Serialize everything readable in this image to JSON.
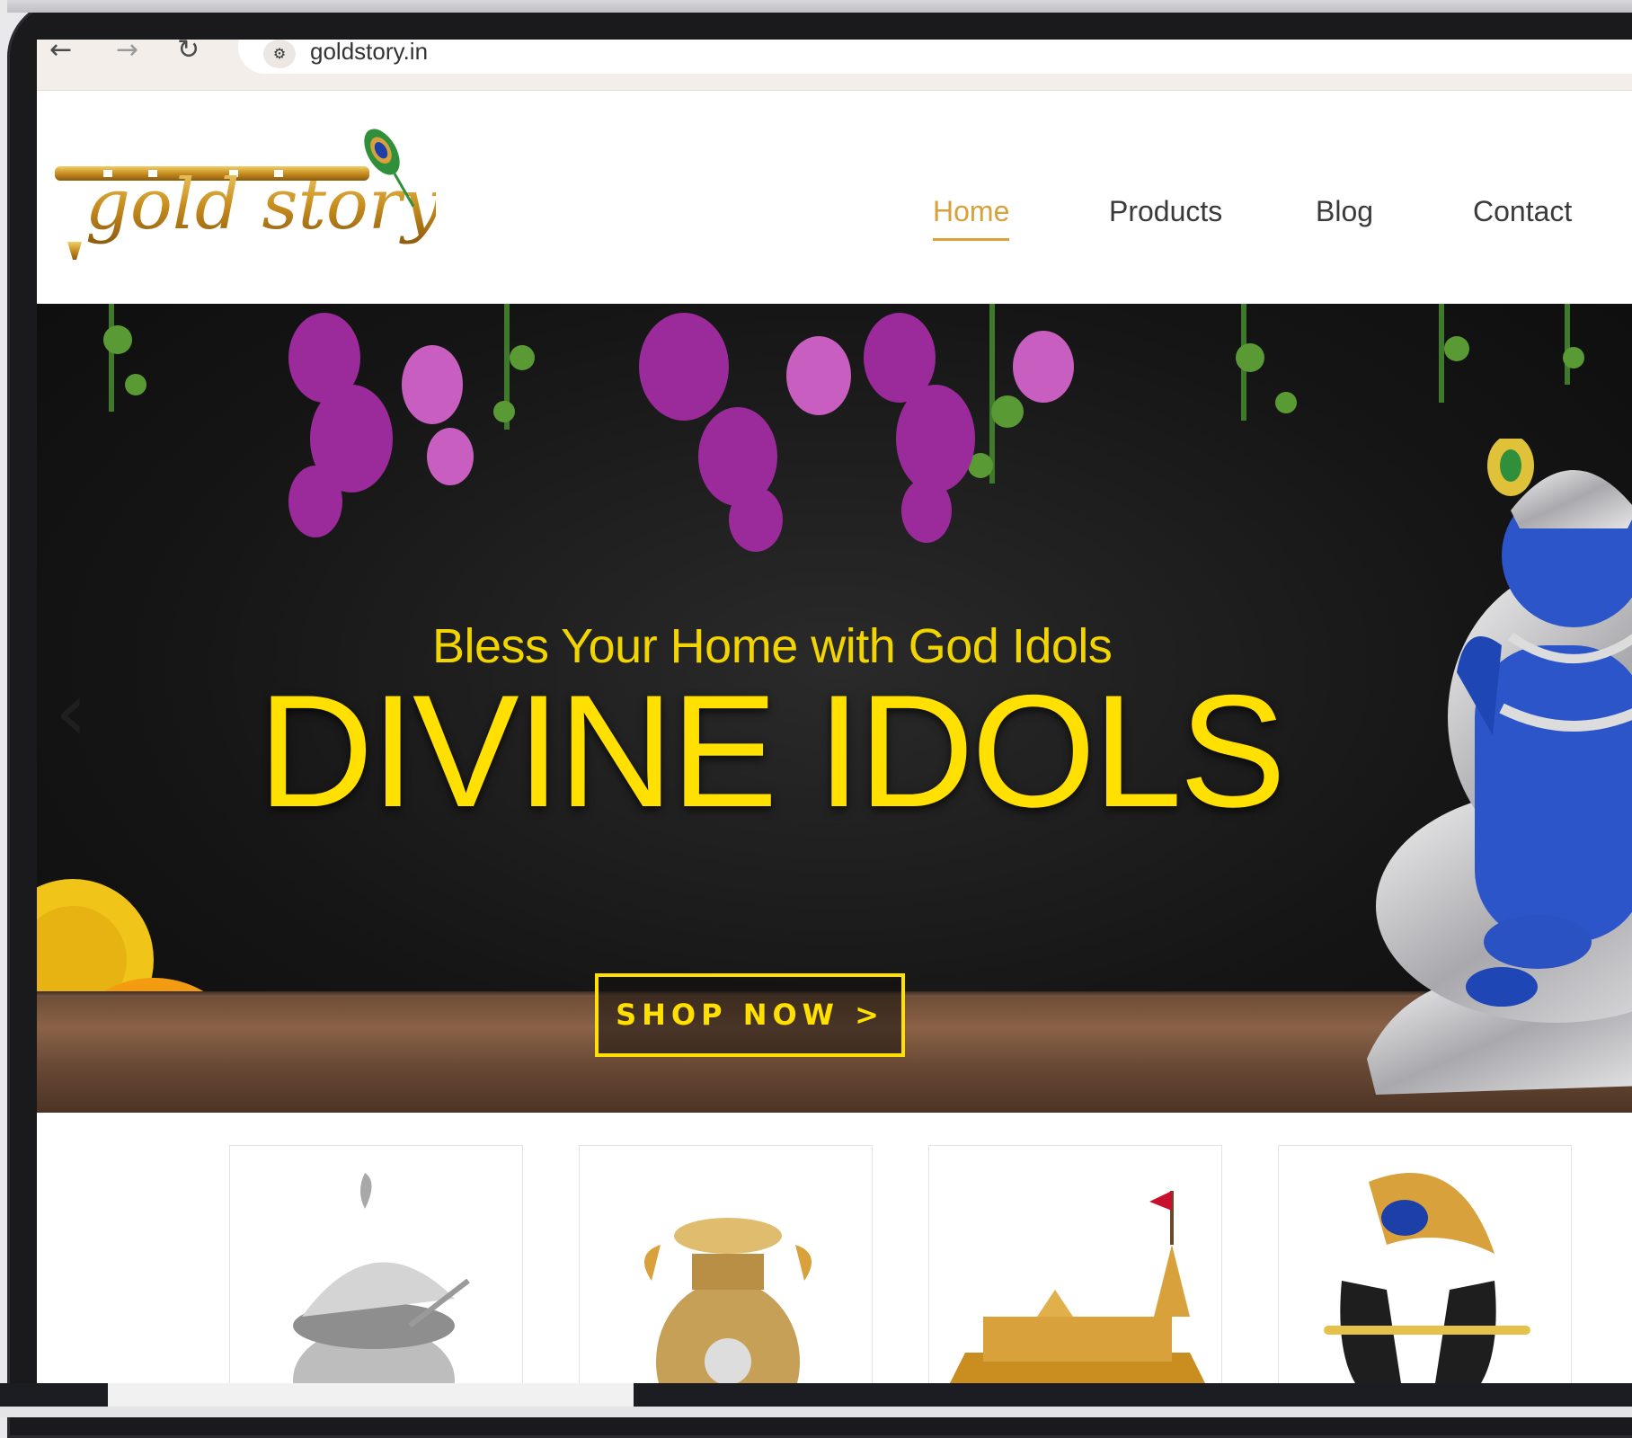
{
  "browser": {
    "back_icon": "arrow-left-icon",
    "forward_icon": "arrow-right-icon",
    "reload_icon": "reload-icon",
    "site_info_icon": "site-settings-icon",
    "url": "goldstory.in"
  },
  "header": {
    "logo_text": "gold story",
    "menu": [
      {
        "label": "Home",
        "active": true
      },
      {
        "label": "Products",
        "active": false
      },
      {
        "label": "Blog",
        "active": false
      },
      {
        "label": "Contact",
        "active": false
      }
    ]
  },
  "hero": {
    "subtitle": "Bless Your Home with God Idols",
    "title": "DIVINE IDOLS",
    "cta": "SHOP NOW >",
    "prev_icon": "chevron-left-icon"
  },
  "products": [
    {
      "name": "silver-peacock-bowl"
    },
    {
      "name": "gold-kalash-coins"
    },
    {
      "name": "ram-mandir-model"
    },
    {
      "name": "krishna-flute-peacock-feather"
    }
  ],
  "colors": {
    "accent_gold": "#d9a13c",
    "hero_yellow": "#ffe000",
    "hero_bg": "#151515"
  }
}
